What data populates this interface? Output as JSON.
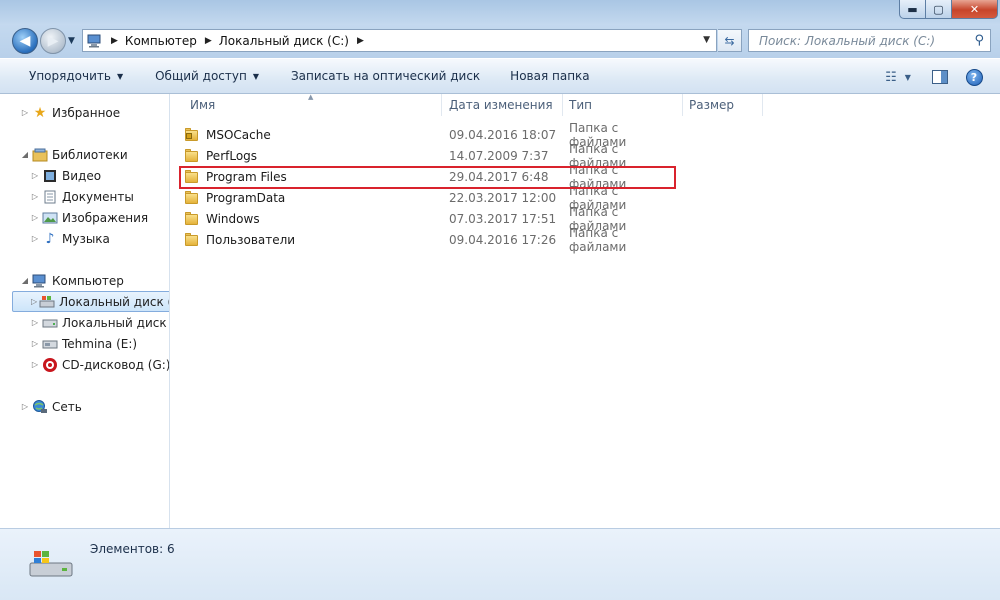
{
  "window": {
    "min_label": "▬",
    "max_label": "▢",
    "close_label": "✕"
  },
  "address": {
    "crumbs": [
      "Компьютер",
      "Локальный диск (C:)"
    ],
    "search_placeholder": "Поиск: Локальный диск (C:)"
  },
  "toolbar": {
    "organize": "Упорядочить",
    "share": "Общий доступ",
    "burn": "Записать на оптический диск",
    "new_folder": "Новая папка"
  },
  "navpane": {
    "favorites": "Избранное",
    "libraries": "Библиотеки",
    "video": "Видео",
    "documents": "Документы",
    "images": "Изображения",
    "music": "Музыка",
    "computer": "Компьютер",
    "drive_c": "Локальный диск (C:)",
    "drive_d": "Локальный диск (D:)",
    "drive_e": "Tehmina (E:)",
    "drive_g": "CD-дисковод (G:) C",
    "network": "Сеть"
  },
  "columns": {
    "name": "Имя",
    "date": "Дата изменения",
    "type": "Тип",
    "size": "Размер"
  },
  "files": [
    {
      "name": "MSOCache",
      "date": "09.04.2016 18:07",
      "type": "Папка с файлами"
    },
    {
      "name": "PerfLogs",
      "date": "14.07.2009 7:37",
      "type": "Папка с файлами"
    },
    {
      "name": "Program Files",
      "date": "29.04.2017 6:48",
      "type": "Папка с файлами"
    },
    {
      "name": "ProgramData",
      "date": "22.03.2017 12:00",
      "type": "Папка с файлами"
    },
    {
      "name": "Windows",
      "date": "07.03.2017 17:51",
      "type": "Папка с файлами"
    },
    {
      "name": "Пользователи",
      "date": "09.04.2016 17:26",
      "type": "Папка с файлами"
    }
  ],
  "status": {
    "items": "Элементов: 6"
  },
  "colors": {
    "highlight": "#d9232d",
    "folder": "#e4b33b"
  }
}
